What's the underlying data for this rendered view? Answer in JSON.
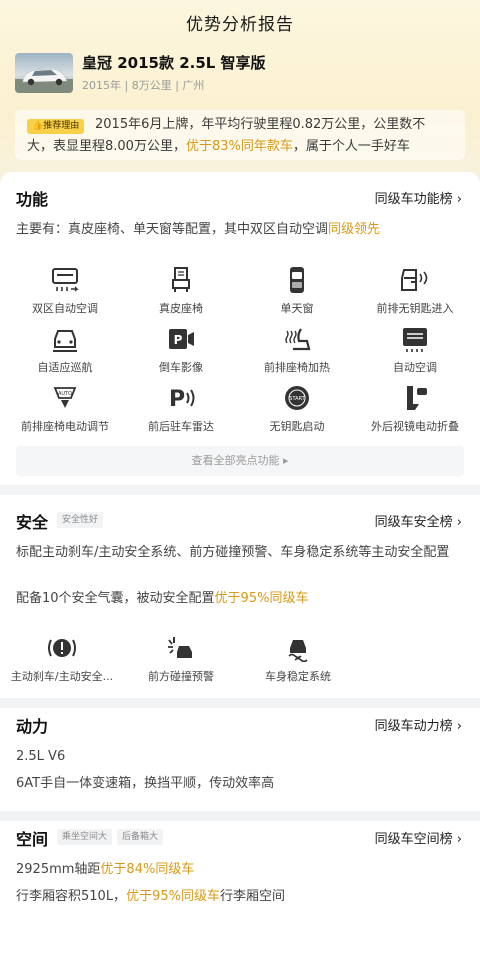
{
  "header": {
    "title": "优势分析报告"
  },
  "car": {
    "name": "皇冠 2015款 2.5L 智享版",
    "meta": "2015年 | 8万公里 | 广州"
  },
  "reason": {
    "tag": "推荐理由",
    "text_a": "2015年6月上牌，年平均行驶里程0.82万公里，公里数不大，表显里程8.00万公里，",
    "text_hl": "优于83%同年款车",
    "text_b": "，属于个人一手好车"
  },
  "function": {
    "title": "功能",
    "link": "同级车功能榜 ›",
    "summary_a": "主要有：真皮座椅、单天窗等配置，其中双区自动空调",
    "summary_hl": "同级领先",
    "items": [
      {
        "label": "双区自动空调",
        "icon": "dual-zone-ac-icon"
      },
      {
        "label": "真皮座椅",
        "icon": "leather-seat-icon"
      },
      {
        "label": "单天窗",
        "icon": "sunroof-icon"
      },
      {
        "label": "前排无钥匙进入",
        "icon": "keyless-entry-icon"
      },
      {
        "label": "自适应巡航",
        "icon": "adaptive-cruise-icon"
      },
      {
        "label": "倒车影像",
        "icon": "rear-camera-icon"
      },
      {
        "label": "前排座椅加热",
        "icon": "seat-heating-icon"
      },
      {
        "label": "自动空调",
        "icon": "auto-ac-icon"
      },
      {
        "label": "前排座椅电动调节",
        "icon": "power-seat-icon"
      },
      {
        "label": "前后驻车雷达",
        "icon": "parking-radar-icon"
      },
      {
        "label": "无钥匙启动",
        "icon": "keyless-start-icon"
      },
      {
        "label": "外后视镜电动折叠",
        "icon": "mirror-fold-icon"
      }
    ],
    "more": "查看全部亮点功能 ▸"
  },
  "safety": {
    "title": "安全",
    "badge": "安全性好",
    "link": "同级车安全榜 ›",
    "line1": "标配主动刹车/主动安全系统、前方碰撞预警、车身稳定系统等主动安全配置",
    "line2_a": "配备10个安全气囊，被动安全配置",
    "line2_hl": "优于95%同级车",
    "items": [
      {
        "label": "主动刹车/主动安全...",
        "icon": "active-brake-icon"
      },
      {
        "label": "前方碰撞预警",
        "icon": "collision-warning-icon"
      },
      {
        "label": "车身稳定系统",
        "icon": "stability-control-icon"
      }
    ]
  },
  "power": {
    "title": "动力",
    "link": "同级车动力榜 ›",
    "line1": "2.5L V6",
    "line2": "6AT手自一体变速箱，换挡平顺，传动效率高"
  },
  "space": {
    "title": "空间",
    "badge1": "乘坐空间大",
    "badge2": "后备箱大",
    "link": "同级车空间榜 ›",
    "line1_a": "2925mm轴距",
    "line1_hl": "优于84%同级车",
    "line2_a": "行李厢容积510L，",
    "line2_hl": "优于95%同级车",
    "line2_b": "行李厢空间"
  },
  "colors": {
    "accent": "#d89a16",
    "tag": "#f9d04a"
  }
}
